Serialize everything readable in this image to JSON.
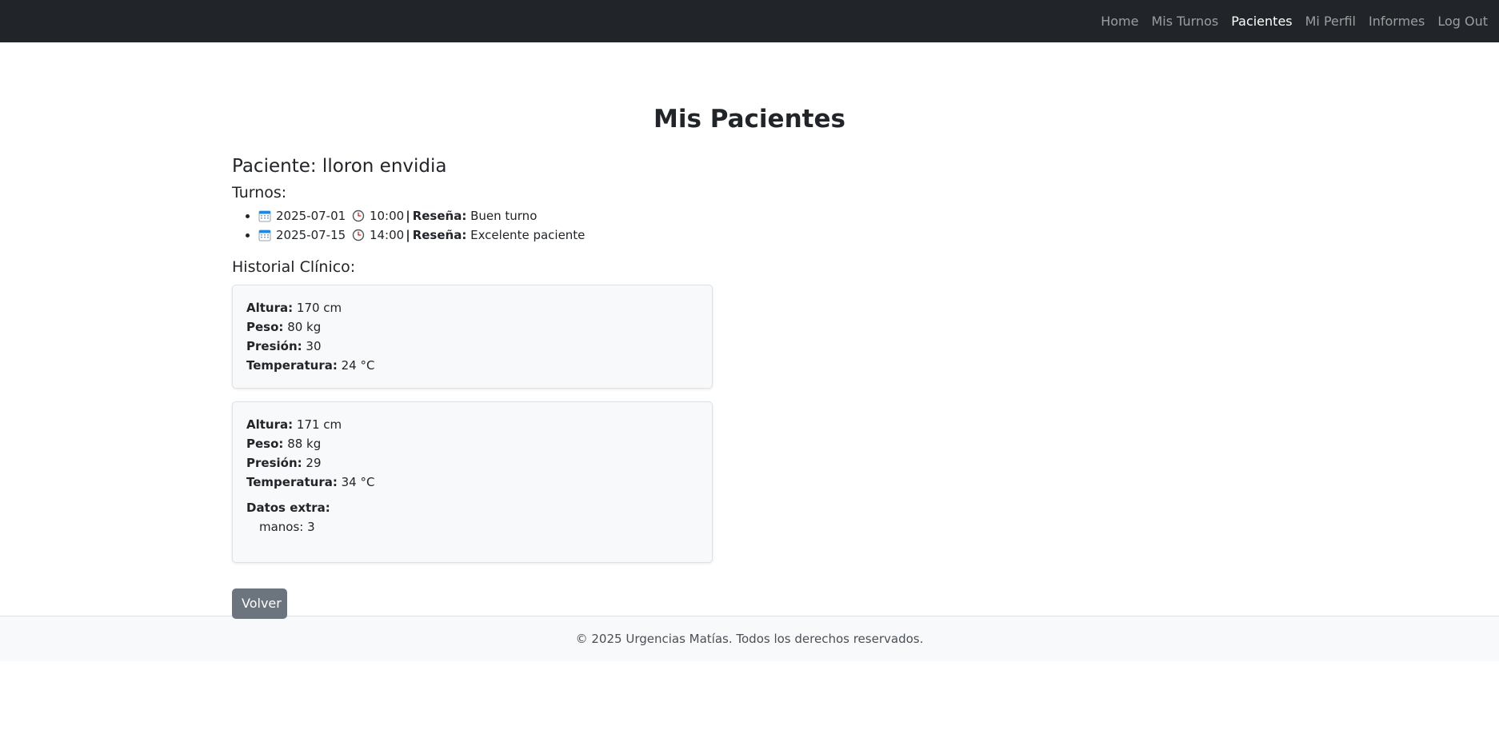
{
  "nav": {
    "items": [
      {
        "label": "Home",
        "active": false
      },
      {
        "label": "Mis Turnos",
        "active": false
      },
      {
        "label": "Pacientes",
        "active": true
      },
      {
        "label": "Mi Perfil",
        "active": false
      },
      {
        "label": "Informes",
        "active": false
      },
      {
        "label": "Log Out",
        "active": false
      }
    ]
  },
  "page": {
    "title": "Mis Pacientes"
  },
  "patient": {
    "label": "Paciente: lloron envidia",
    "turnos_heading": "Turnos:",
    "turnos": [
      {
        "date": "2025-07-01",
        "time": "10:00",
        "review_label": "Reseña:",
        "review": "Buen turno"
      },
      {
        "date": "2025-07-15",
        "time": "14:00",
        "review_label": "Reseña:",
        "review": "Excelente paciente"
      }
    ],
    "historial_heading": "Historial Clínico:",
    "historial": [
      {
        "altura_label": "Altura:",
        "altura": "170 cm",
        "peso_label": "Peso:",
        "peso": "80 kg",
        "presion_label": "Presión:",
        "presion": "30",
        "temp_label": "Temperatura:",
        "temp": "24 °C"
      },
      {
        "altura_label": "Altura:",
        "altura": "171 cm",
        "peso_label": "Peso:",
        "peso": "88 kg",
        "presion_label": "Presión:",
        "presion": "29",
        "temp_label": "Temperatura:",
        "temp": "34 °C",
        "extra_label": "Datos extra:",
        "extra": [
          "manos: 3"
        ]
      }
    ]
  },
  "actions": {
    "back_label": "Volver"
  },
  "footer": {
    "text": "© 2025 Urgencias Matías. Todos los derechos reservados."
  },
  "icons": {
    "calendar": "calendar-icon",
    "clock": "clock-icon"
  },
  "colors": {
    "navbar": "#212529",
    "button": "#6c757d",
    "card_bg": "#f8f9fa"
  }
}
